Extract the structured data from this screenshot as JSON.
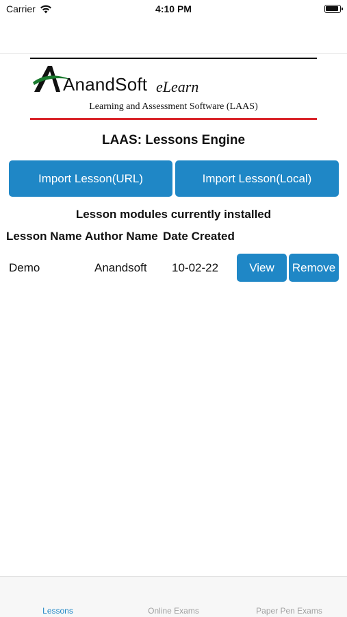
{
  "status_bar": {
    "carrier": "Carrier",
    "time": "4:10 PM"
  },
  "logo": {
    "brand": "AnandSoft",
    "product": "eLearn",
    "tagline": "Learning and Assessment Software (LAAS)"
  },
  "page": {
    "title": "LAAS: Lessons Engine",
    "import_url_label": "Import Lesson(URL)",
    "import_local_label": "Import Lesson(Local)",
    "section_label": "Lesson modules currently installed"
  },
  "table": {
    "headers": [
      "Lesson Name",
      "Author Name",
      "Date Created"
    ],
    "rows": [
      {
        "lesson_name": "Demo",
        "author_name": "Anandsoft",
        "date_created": "10-02-22",
        "view_label": "View",
        "remove_label": "Remove"
      }
    ]
  },
  "tabs": [
    {
      "label": "Lessons",
      "active": true
    },
    {
      "label": "Online Exams",
      "active": false
    },
    {
      "label": "Paper Pen Exams",
      "active": false
    }
  ],
  "colors": {
    "accent": "#1f87c6",
    "logo_rule": "#d9252b",
    "inactive_tab": "#a0a0a0"
  },
  "icons": {
    "wifi": "wifi-icon",
    "battery": "battery-icon",
    "logo_mark": "anandsoft-logo-mark-icon"
  }
}
